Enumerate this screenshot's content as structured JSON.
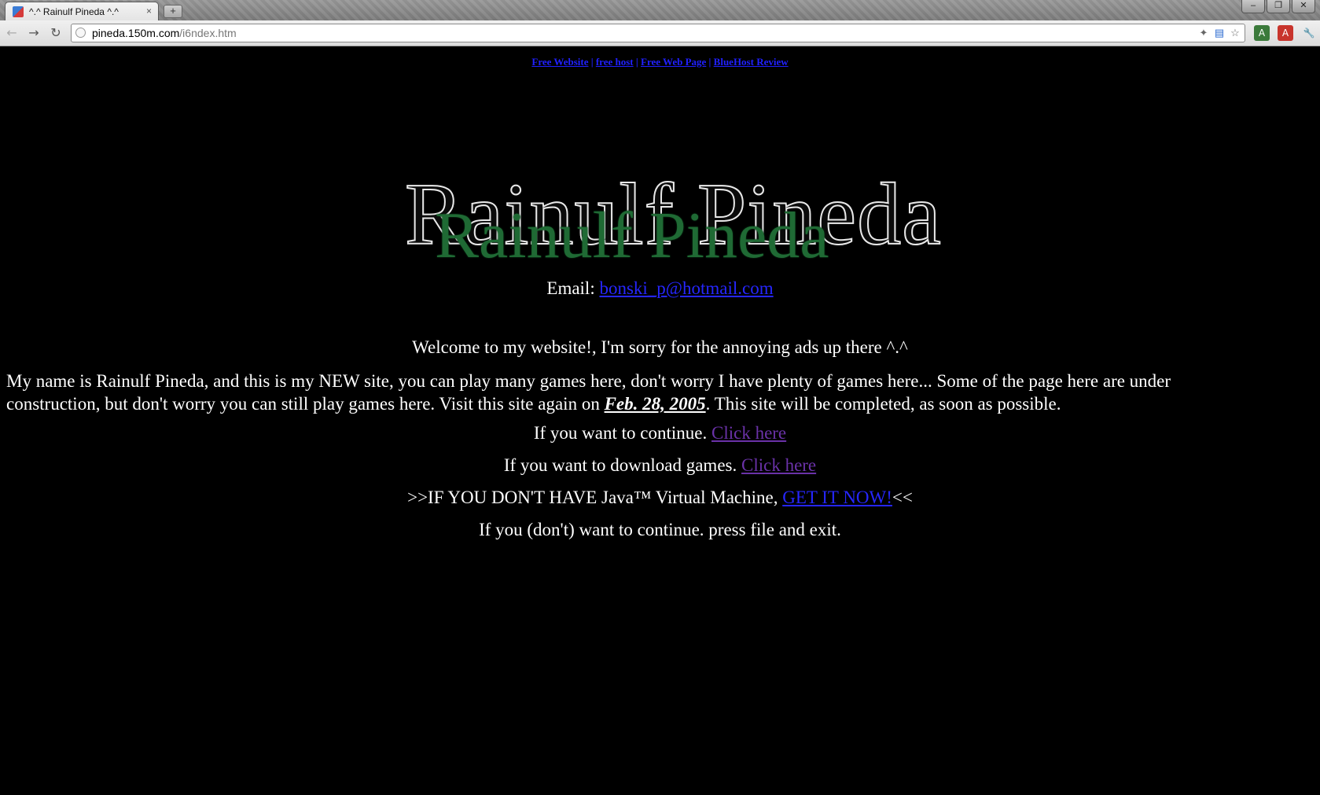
{
  "browser": {
    "tab_title": "^.^ Rainulf Pineda ^.^",
    "tab_close": "×",
    "new_tab": "+",
    "url_host": "pineda.150m.com",
    "url_path": "/i6ndex.htm",
    "window_controls": {
      "minimize": "–",
      "restore": "❐",
      "close": "✕"
    }
  },
  "ads": {
    "links": [
      "Free Website",
      "free host",
      "Free Web Page",
      "BlueHost Review"
    ],
    "separator": " | "
  },
  "logo": {
    "text": "Rainulf Pineda",
    "back_text": "Rainulf Pineda",
    "front_color": "#1f6a34"
  },
  "page": {
    "email_label": "Email: ",
    "email": "bonski_p@hotmail.com",
    "welcome": "Welcome to my website!, I'm sorry for the annoying ads up there ^.^",
    "intro_before": "My name is Rainulf Pineda, and this is my NEW site, you can play many games here, don't worry I have plenty of games here... Some of the page here are under construction, but don't worry you can still play games here. Visit this site again on ",
    "intro_date": "Feb. 28, 2005",
    "intro_after": ". This site will be completed, as soon as possible.",
    "continue_text": "If you want to continue. ",
    "continue_link": "Click here",
    "download_text": "If you want to download games. ",
    "download_link": "Click here",
    "java_before": ">>IF YOU DON'T HAVE Java™ Virtual Machine, ",
    "java_link": "GET IT NOW!",
    "java_after": "<<",
    "exit_text": "If you (don't) want to continue. press file and exit."
  },
  "colors": {
    "background": "#000000",
    "link": "#2626ff",
    "visited_link": "#6a32a8",
    "text": "#ffffff"
  }
}
